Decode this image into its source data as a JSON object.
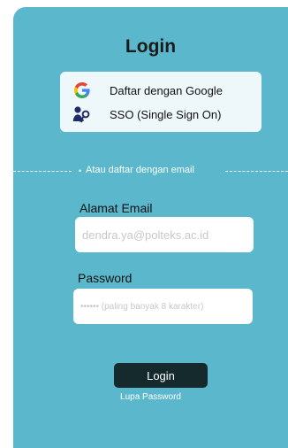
{
  "title": "Login",
  "providers": {
    "google": {
      "label": "Daftar dengan Google",
      "icon": "google-icon"
    },
    "sso": {
      "label": "SSO (Single Sign On)",
      "icon": "key-person-icon"
    }
  },
  "divider_text": "Atau daftar dengan email",
  "email": {
    "label": "Alamat Email",
    "placeholder": "dendra.ya@polteks.ac.id"
  },
  "password": {
    "label": "Password",
    "placeholder": "•••••• (paling banyak 8 karakter)"
  },
  "login_button": "Login",
  "forgot_link": "Lupa Password",
  "colors": {
    "card_bg": "#5bb8cc",
    "button_bg": "#152a2c",
    "google_blue": "#4285f4",
    "google_red": "#ea4335",
    "google_yellow": "#fbbc05",
    "google_green": "#34a853"
  }
}
